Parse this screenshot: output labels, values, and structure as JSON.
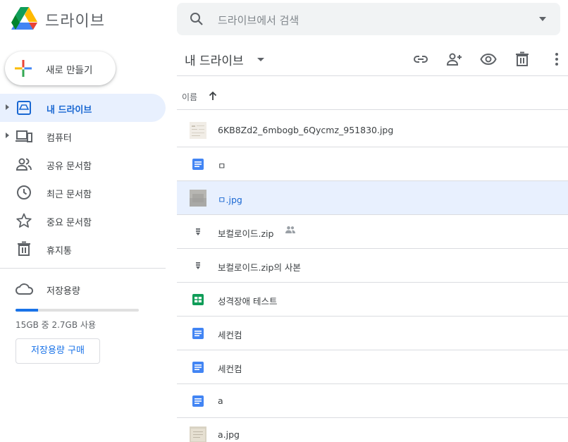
{
  "app": {
    "title": "드라이브"
  },
  "search": {
    "placeholder": "드라이브에서 검색"
  },
  "sidebar": {
    "new_button": "새로 만들기",
    "items": [
      {
        "label": "내 드라이브",
        "icon": "drive-icon",
        "active": true,
        "expandable": true
      },
      {
        "label": "컴퓨터",
        "icon": "computer-icon",
        "active": false,
        "expandable": true
      },
      {
        "label": "공유 문서함",
        "icon": "people-icon",
        "active": false,
        "expandable": false
      },
      {
        "label": "최근 문서함",
        "icon": "clock-icon",
        "active": false,
        "expandable": false
      },
      {
        "label": "중요 문서함",
        "icon": "star-icon",
        "active": false,
        "expandable": false
      },
      {
        "label": "휴지통",
        "icon": "trash-icon",
        "active": false,
        "expandable": false
      }
    ],
    "storage": {
      "label": "저장용량",
      "usage": "15GB 중 2.7GB 사용",
      "used_fraction": 0.18,
      "buy_button": "저장용량 구매"
    }
  },
  "main": {
    "breadcrumb": "내 드라이브",
    "toolbar_icons": [
      "link-icon",
      "add-person-icon",
      "eye-icon",
      "trash-icon",
      "more-vert-icon"
    ],
    "sort_label": "이름",
    "files": [
      {
        "name": "6KB8Zd2_6mbogb_6Qycmz_951830.jpg",
        "type": "image",
        "selected": false,
        "shared": false
      },
      {
        "name": "ㅁ",
        "type": "doc",
        "selected": false,
        "shared": false
      },
      {
        "name": "ㅁ.jpg",
        "type": "image",
        "selected": true,
        "shared": false
      },
      {
        "name": "보컬로이드.zip",
        "type": "zip",
        "selected": false,
        "shared": true
      },
      {
        "name": "보컬로이드.zip의 사본",
        "type": "zip",
        "selected": false,
        "shared": false
      },
      {
        "name": "성격장애 테스트",
        "type": "sheet",
        "selected": false,
        "shared": false
      },
      {
        "name": "세컨컴",
        "type": "doc",
        "selected": false,
        "shared": false
      },
      {
        "name": "세컨컴",
        "type": "doc",
        "selected": false,
        "shared": false
      },
      {
        "name": "a",
        "type": "doc",
        "selected": false,
        "shared": false
      },
      {
        "name": "a.jpg",
        "type": "image",
        "selected": false,
        "shared": false
      }
    ]
  },
  "colors": {
    "accent": "#1a73e8",
    "active_bg": "#e8f0fe",
    "doc": "#4285f4",
    "sheet": "#0f9d58"
  }
}
